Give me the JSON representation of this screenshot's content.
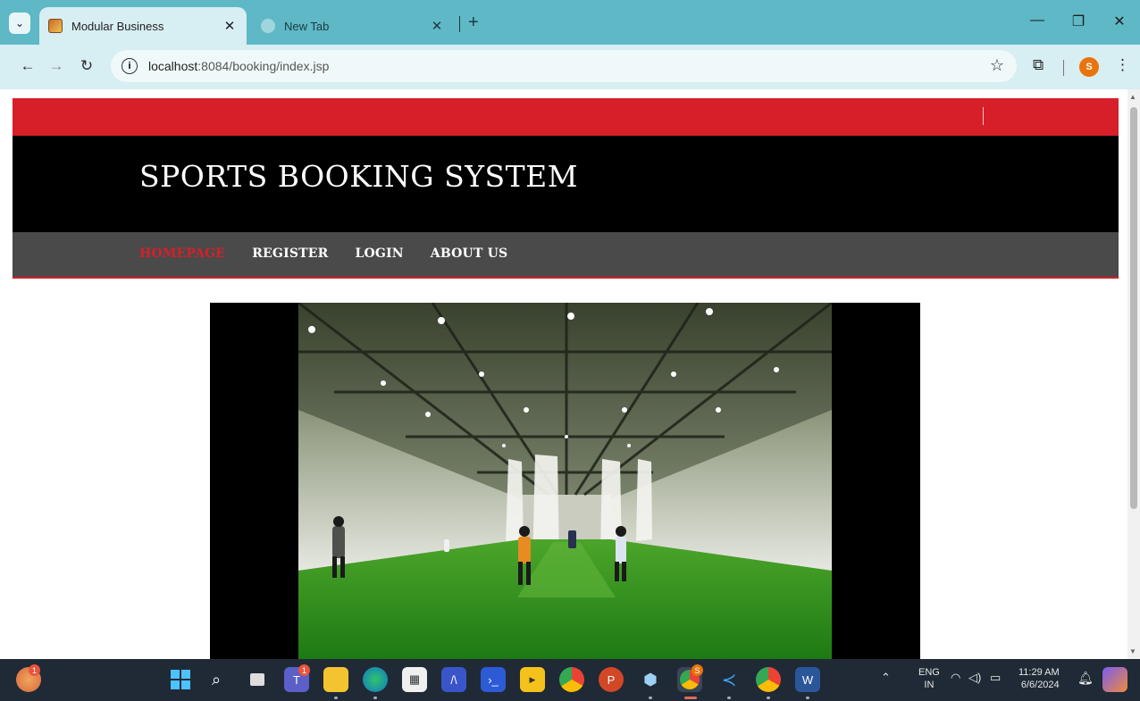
{
  "browser": {
    "tabs": [
      {
        "title": "Modular Business",
        "active": true
      },
      {
        "title": "New Tab",
        "active": false
      }
    ],
    "url_host": "localhost",
    "url_rest": ":8084/booking/index.jsp",
    "profile_initial": "S"
  },
  "site": {
    "title": "SPORTS BOOKING SYSTEM",
    "menu": [
      {
        "label": "HOMEPAGE",
        "current": true
      },
      {
        "label": "REGISTER",
        "current": false
      },
      {
        "label": "LOGIN",
        "current": false
      },
      {
        "label": "ABOUT US",
        "current": false
      }
    ],
    "colors": {
      "accent": "#d71f2a",
      "header": "#000000",
      "menubar": "#4a4a4a"
    }
  },
  "taskbar": {
    "start_badge": "1",
    "teams_badge": "1",
    "chrome_badge": "S",
    "lang_top": "ENG",
    "lang_bottom": "IN",
    "time": "11:29 AM",
    "date": "6/6/2024"
  }
}
